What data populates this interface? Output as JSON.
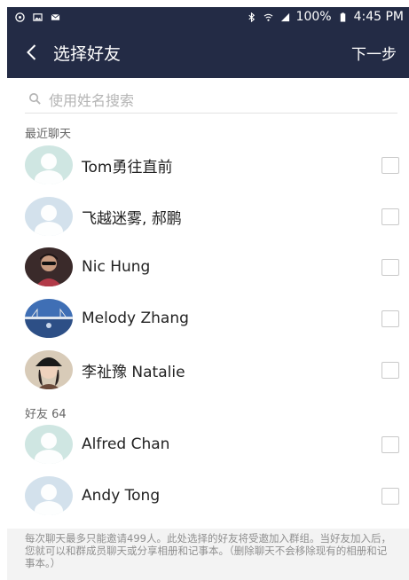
{
  "status_bar": {
    "battery": "100%",
    "time": "4:45 PM"
  },
  "nav": {
    "title": "选择好友",
    "next": "下一步"
  },
  "search": {
    "placeholder": "使用姓名搜索"
  },
  "sections": {
    "recent": "最近聊天",
    "friends": "好友 64"
  },
  "recent_contacts": [
    {
      "name": "Tom勇往直前",
      "avatar": "default-teal"
    },
    {
      "name": "飞越迷雾, 郝鹏",
      "avatar": "default-blue"
    },
    {
      "name": "Nic Hung",
      "avatar": "photo-person-sunglasses"
    },
    {
      "name": "Melody Zhang",
      "avatar": "photo-bridge-sky"
    },
    {
      "name": "李祉豫 Natalie",
      "avatar": "photo-person-black-hat"
    }
  ],
  "friends_contacts": [
    {
      "name": "Alfred Chan",
      "avatar": "default-teal"
    },
    {
      "name": "Andy Tong",
      "avatar": "default-blue"
    }
  ],
  "footer": {
    "text": "每次聊天最多只能邀请499人。此处选择的好友将受邀加入群组。当好友加入后，您就可以和群成员聊天或分享相册和记事本。（删除聊天不会移除现有的相册和记事本。）"
  },
  "colors": {
    "header_bg": "#232b45",
    "checkbox_border": "#c9c9c9",
    "footer_bg": "#f3f3f3"
  }
}
